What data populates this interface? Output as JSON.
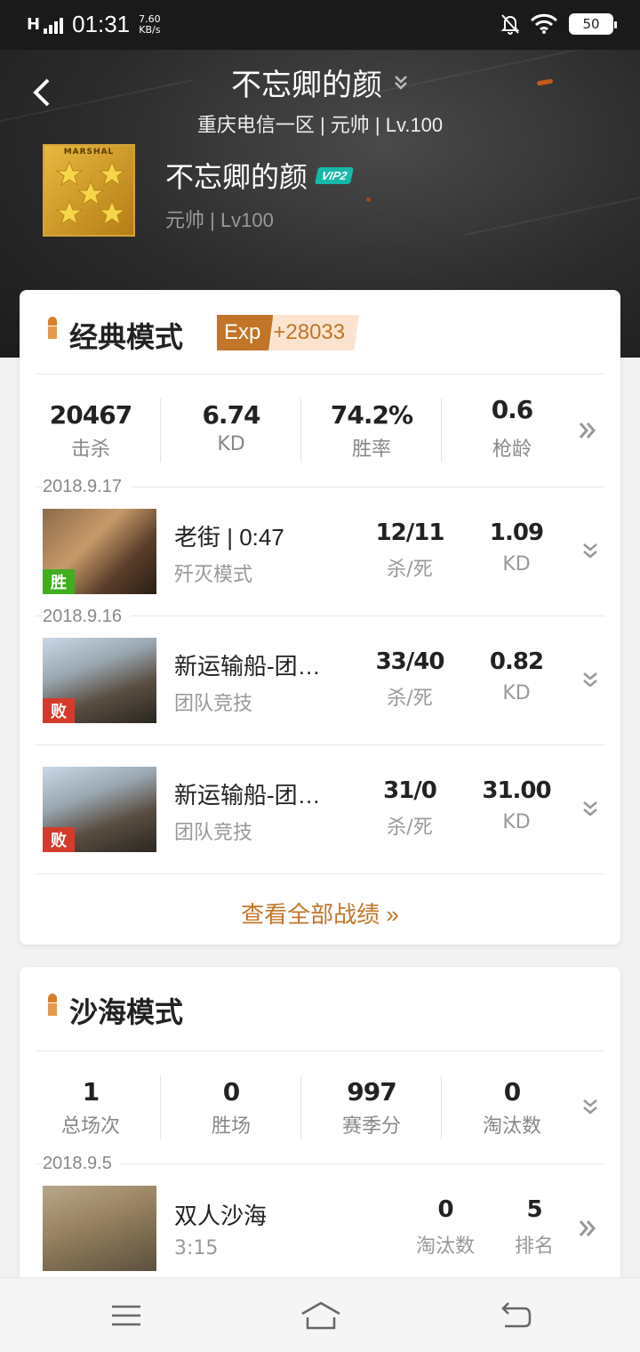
{
  "status_bar": {
    "network": "H",
    "time": "01:31",
    "speed_value": "7.60",
    "speed_unit": "KB/s",
    "battery": "50"
  },
  "header": {
    "title": "不忘卿的颜",
    "subtitle": "重庆电信一区 | 元帅 | Lv.100",
    "player_name": "不忘卿的颜",
    "vip_badge": "VIP2",
    "player_rank": "元帅 | Lv100",
    "avatar_text": "MARSHAL"
  },
  "classic": {
    "title": "经典模式",
    "exp_label": "Exp",
    "exp_value": "+28033",
    "stats": [
      {
        "value": "20467",
        "label": "击杀"
      },
      {
        "value": "6.74",
        "label": "KD"
      },
      {
        "value": "74.2%",
        "label": "胜率"
      },
      {
        "value": "0.6",
        "label": "枪龄"
      }
    ],
    "matches": [
      {
        "date": "2018.9.17",
        "name": "老街 | 0:47",
        "mode": "歼灭模式",
        "kd_ratio": "12/11",
        "kd_ratio_label": "杀/死",
        "kd": "1.09",
        "kd_label": "KD",
        "result": "胜"
      },
      {
        "date": "2018.9.16",
        "name": "新运输船-团…",
        "mode": "团队竞技",
        "kd_ratio": "33/40",
        "kd_ratio_label": "杀/死",
        "kd": "0.82",
        "kd_label": "KD",
        "result": "败"
      },
      {
        "date": "",
        "name": "新运输船-团…",
        "mode": "团队竞技",
        "kd_ratio": "31/0",
        "kd_ratio_label": "杀/死",
        "kd": "31.00",
        "kd_label": "KD",
        "result": "败"
      }
    ],
    "view_all": "查看全部战绩 »"
  },
  "desert": {
    "title": "沙海模式",
    "stats": [
      {
        "value": "1",
        "label": "总场次"
      },
      {
        "value": "0",
        "label": "胜场"
      },
      {
        "value": "997",
        "label": "赛季分"
      },
      {
        "value": "0",
        "label": "淘汰数"
      }
    ],
    "match": {
      "date": "2018.9.5",
      "name": "双人沙海",
      "duration": "3:15",
      "elims": "0",
      "elims_label": "淘汰数",
      "rank": "5",
      "rank_label": "排名"
    }
  },
  "colors": {
    "accent": "#c27529",
    "win": "#3fae1f",
    "lose": "#d33b2c",
    "vip": "#17b8a8"
  }
}
